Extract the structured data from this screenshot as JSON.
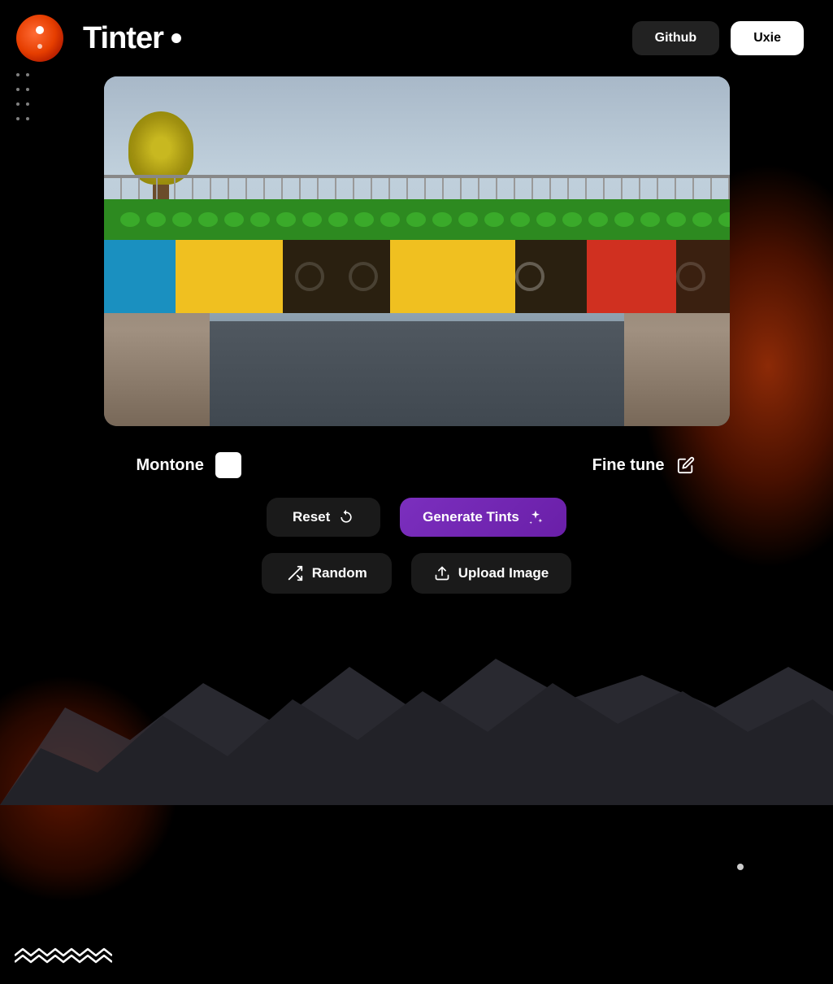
{
  "app": {
    "title": "Tinter",
    "title_dot": "•"
  },
  "header": {
    "github_label": "Github",
    "uxie_label": "Uxie"
  },
  "controls": {
    "montone_label": "Montone",
    "fine_tune_label": "Fine tune",
    "reset_label": "Reset",
    "generate_label": "Generate Tints",
    "random_label": "Random",
    "upload_label": "Upload Image"
  },
  "icons": {
    "reset": "↺",
    "sparkle": "✦",
    "random": "⇄",
    "upload": "⬆",
    "pencil": "✏"
  },
  "logo_dots": {
    "rows": [
      [
        "•",
        "•"
      ],
      [
        "•",
        "•"
      ],
      [
        "•",
        "•"
      ],
      [
        "•",
        "•"
      ]
    ]
  }
}
